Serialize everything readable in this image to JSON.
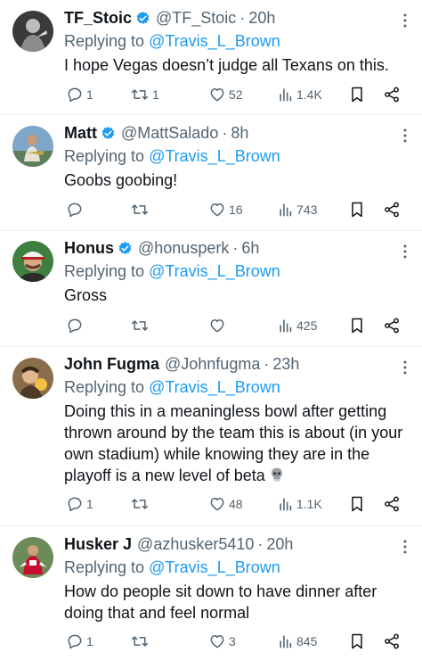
{
  "tweets": [
    {
      "name": "TF_Stoic",
      "handle": "@TF_Stoic",
      "time": "20h",
      "verified": true,
      "reply_prefix": "Replying to",
      "reply_to": "@Travis_L_Brown",
      "text": "I hope Vegas doesn’t judge all Texans on this.",
      "replies": "1",
      "retweets": "1",
      "likes": "52",
      "views": "1.4K"
    },
    {
      "name": "Matt",
      "handle": "@MattSalado",
      "time": "8h",
      "verified": true,
      "reply_prefix": "Replying to",
      "reply_to": "@Travis_L_Brown",
      "text": "Goobs goobing!",
      "replies": "",
      "retweets": "",
      "likes": "16",
      "views": "743"
    },
    {
      "name": "Honus",
      "handle": "@honusperk",
      "time": "6h",
      "verified": true,
      "reply_prefix": "Replying to",
      "reply_to": "@Travis_L_Brown",
      "text": "Gross",
      "replies": "",
      "retweets": "",
      "likes": "",
      "views": "425"
    },
    {
      "name": "John Fugma",
      "handle": "@Johnfugma",
      "time": "23h",
      "verified": false,
      "reply_prefix": "Replying to",
      "reply_to": "@Travis_L_Brown",
      "text": "Doing this in a meaningless bowl after getting thrown around by the team this is about (in your own stadium) while knowing they are in the playoff is a new level of beta",
      "emoji": "skull-emoji",
      "replies": "1",
      "retweets": "",
      "likes": "48",
      "views": "1.1K"
    },
    {
      "name": "Husker J",
      "handle": "@azhusker5410",
      "time": "20h",
      "verified": false,
      "reply_prefix": "Replying to",
      "reply_to": "@Travis_L_Brown",
      "text": "How do people sit down to have dinner after doing that and feel normal",
      "replies": "1",
      "retweets": "",
      "likes": "3",
      "views": "845"
    }
  ],
  "colors": {
    "text": "#0f1419",
    "secondary": "#536471",
    "link": "#1d9bf0",
    "divider": "#eff3f4"
  },
  "icons": [
    "reply-icon",
    "retweet-icon",
    "like-icon",
    "views-icon",
    "bookmark-icon",
    "share-icon",
    "verified-badge-icon",
    "more-icon"
  ]
}
